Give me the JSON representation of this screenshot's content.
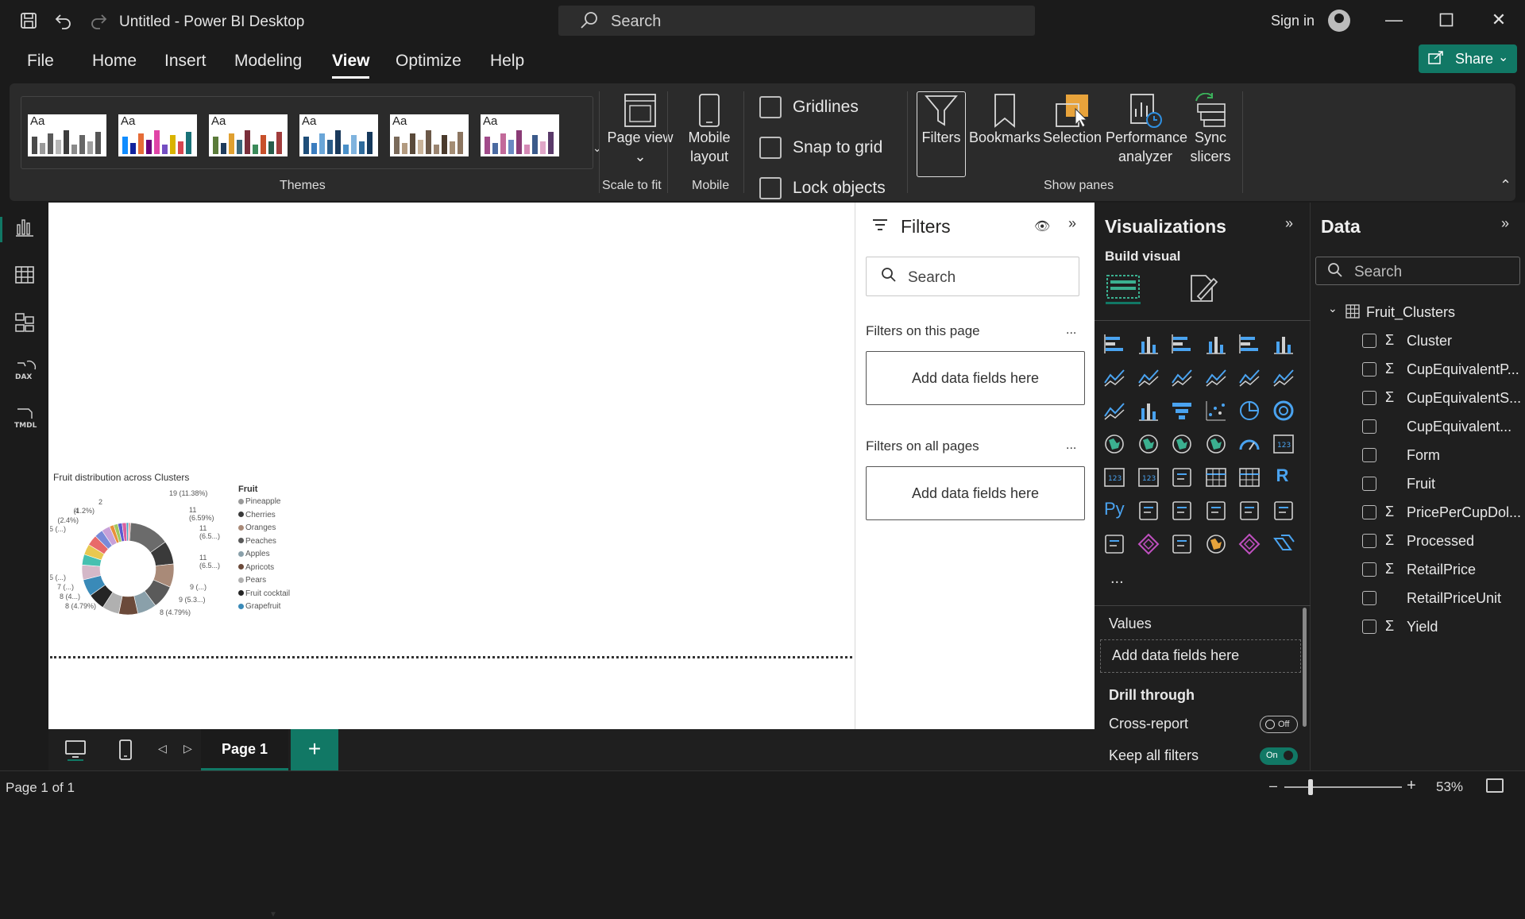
{
  "titlebar": {
    "title": "Untitled - Power BI Desktop",
    "search_placeholder": "Search",
    "signin": "Sign in"
  },
  "menu": {
    "items": [
      "File",
      "Home",
      "Insert",
      "Modeling",
      "View",
      "Optimize",
      "Help"
    ],
    "active": "View",
    "share_label": "Share"
  },
  "ribbon": {
    "themes_label": "Themes",
    "theme_tile_text": "Aa",
    "page_view": "Page view",
    "scale_to_fit": "Scale to fit",
    "mobile_layout": "Mobile layout",
    "mobile": "Mobile",
    "gridlines": "Gridlines",
    "snap_to_grid": "Snap to grid",
    "lock_objects": "Lock objects",
    "filters": "Filters",
    "bookmarks": "Bookmarks",
    "selection": "Selection",
    "performance_analyzer": "Performance analyzer",
    "sync_slicers": "Sync slicers",
    "show_panes": "Show panes",
    "theme_palettes": [
      [
        "#4a4a4a",
        "#9a9a9a",
        "#5a5a5a",
        "#b7b7b7",
        "#3c3c3c",
        "#8a8a8a",
        "#666666",
        "#a0a0a0",
        "#555555"
      ],
      [
        "#118dff",
        "#12239e",
        "#e66c37",
        "#6b007b",
        "#e044a7",
        "#744ec2",
        "#d9b300",
        "#d64550",
        "#197278"
      ],
      [
        "#5b7b3a",
        "#1f3b5b",
        "#e0a030",
        "#39687c",
        "#7a2e3a",
        "#3b8a5a",
        "#c7502a",
        "#275c4a",
        "#a13c3c"
      ],
      [
        "#1f4e79",
        "#3b7dbf",
        "#6aa6d8",
        "#2b5d8a",
        "#1a3a5c",
        "#4a90c8",
        "#7fb3de",
        "#2e6b9c",
        "#15395c"
      ],
      [
        "#7a6a5a",
        "#b29a80",
        "#5a4a3a",
        "#c9b39a",
        "#6b5848",
        "#9a8470",
        "#4a3a2c",
        "#a48d74",
        "#8c7560"
      ],
      [
        "#a14b8a",
        "#4b6aa1",
        "#c26a9a",
        "#6a8ac2",
        "#8a3b76",
        "#d58ab6",
        "#3b5a8a",
        "#e0a6c8",
        "#5a3a6a"
      ]
    ]
  },
  "chart_data": {
    "type": "pie",
    "donut": true,
    "title": "Fruit distribution across Clusters",
    "legend_title": "Fruit",
    "legend_position": "right",
    "legend": [
      {
        "name": "Pineapple",
        "color": "#9a9a9a"
      },
      {
        "name": "Cherries",
        "color": "#3a3a3a"
      },
      {
        "name": "Oranges",
        "color": "#a98a78"
      },
      {
        "name": "Peaches",
        "color": "#5a5a5a"
      },
      {
        "name": "Apples",
        "color": "#8aa0aa"
      },
      {
        "name": "Apricots",
        "color": "#6b4a3a"
      },
      {
        "name": "Pears",
        "color": "#b0b0b0"
      },
      {
        "name": "Fruit cocktail",
        "color": "#252525"
      },
      {
        "name": "Grapefruit",
        "color": "#3a8ab8"
      }
    ],
    "slices": [
      {
        "value": 19,
        "color": "#6b6b6b"
      },
      {
        "value": 11,
        "color": "#3a3a3a"
      },
      {
        "value": 11,
        "color": "#a98a78"
      },
      {
        "value": 11,
        "color": "#5a5a5a"
      },
      {
        "value": 9,
        "color": "#8aa0aa"
      },
      {
        "value": 9,
        "color": "#6b4a3a"
      },
      {
        "value": 8,
        "color": "#b0b0b0"
      },
      {
        "value": 8,
        "color": "#252525"
      },
      {
        "value": 8,
        "color": "#3a8ab8"
      },
      {
        "value": 7,
        "color": "#d4b8c8"
      },
      {
        "value": 5,
        "color": "#46c0b0"
      },
      {
        "value": 5,
        "color": "#e8c850"
      },
      {
        "value": 5,
        "color": "#e86a6a"
      },
      {
        "value": 4,
        "color": "#7a8ad8"
      },
      {
        "value": 4,
        "color": "#c8a0d8"
      },
      {
        "value": 2,
        "color": "#e8903a"
      },
      {
        "value": 2,
        "color": "#a0c860"
      },
      {
        "value": 2,
        "color": "#5a5ad0"
      },
      {
        "value": 2,
        "color": "#d860a0"
      },
      {
        "value": 1,
        "color": "#40a0c0"
      },
      {
        "value": 1,
        "color": "#f0a0a0"
      }
    ],
    "data_labels": [
      "19 (11.38%)",
      "11",
      "(6.59%)",
      "11",
      "(6.5...)",
      "11",
      "(6.5...)",
      "9 (...)",
      "9 (5.3...)",
      "8 (4.79%)",
      "8 (4.79%)",
      "8 (4...)",
      "7 (...)",
      "5 (...)",
      "5 (...)",
      "(2.4%)",
      "4",
      "(1.2%)",
      "2"
    ]
  },
  "filters": {
    "title": "Filters",
    "search_placeholder": "Search",
    "on_this_page": "Filters on this page",
    "on_all_pages": "Filters on all pages",
    "add_fields": "Add data fields here",
    "more": "..."
  },
  "visualizations": {
    "title": "Visualizations",
    "build_visual": "Build visual",
    "more": "...",
    "values_label": "Values",
    "values_drop": "Add data fields here",
    "drill_through": "Drill through",
    "cross_report": "Cross-report",
    "cross_report_state": "Off",
    "keep_all_filters": "Keep all filters",
    "keep_all_filters_state": "On",
    "r_label": "R",
    "py_label": "Py"
  },
  "data": {
    "title": "Data",
    "search_placeholder": "Search",
    "table": "Fruit_Clusters",
    "fields": [
      {
        "name": "Cluster",
        "sigma": true
      },
      {
        "name": "CupEquivalentP...",
        "sigma": true
      },
      {
        "name": "CupEquivalentS...",
        "sigma": true
      },
      {
        "name": "CupEquivalent...",
        "sigma": false
      },
      {
        "name": "Form",
        "sigma": false
      },
      {
        "name": "Fruit",
        "sigma": false
      },
      {
        "name": "PricePerCupDol...",
        "sigma": true
      },
      {
        "name": "Processed",
        "sigma": true
      },
      {
        "name": "RetailPrice",
        "sigma": true
      },
      {
        "name": "RetailPriceUnit",
        "sigma": false
      },
      {
        "name": "Yield",
        "sigma": true
      }
    ]
  },
  "pages": {
    "tab_label": "Page 1",
    "add_label": "+"
  },
  "status": {
    "page_indicator": "Page 1 of 1",
    "zoom": "53%"
  },
  "colors": {
    "accent": "#117865",
    "bg": "#1b1b1b"
  }
}
